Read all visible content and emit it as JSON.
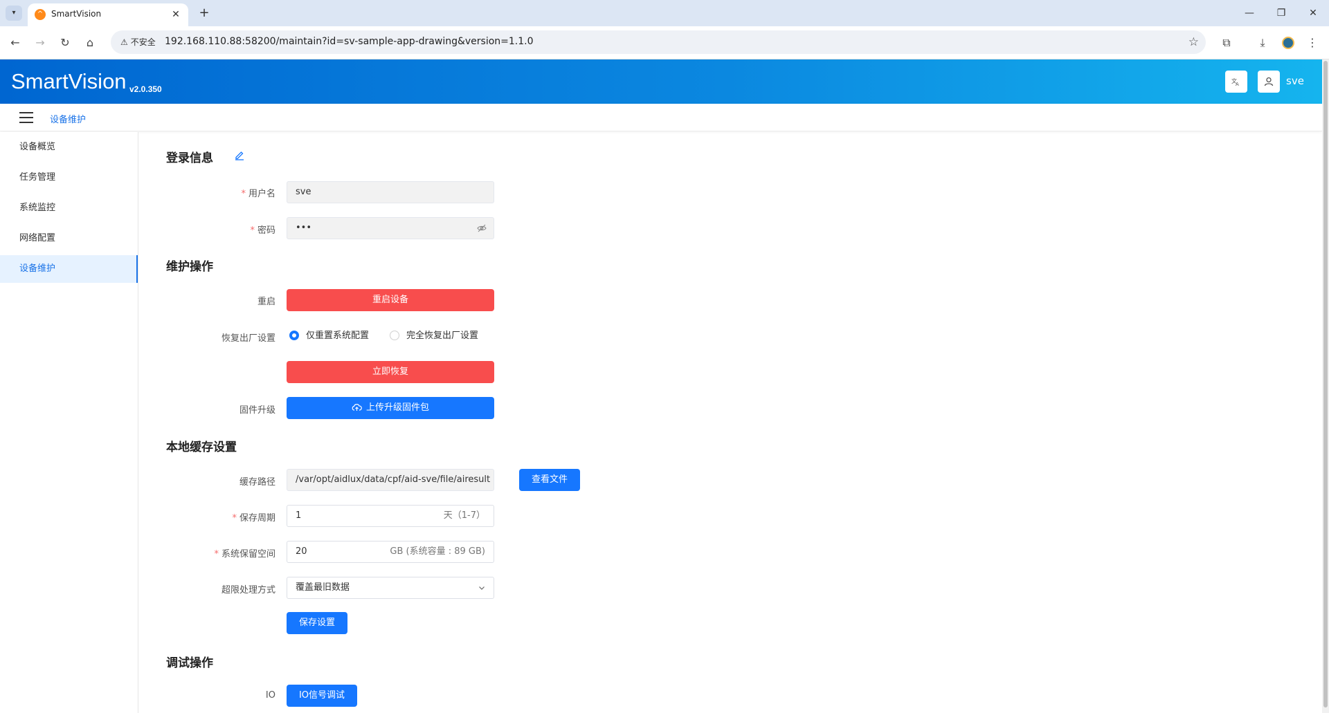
{
  "browser": {
    "tab_title": "SmartVision",
    "security_label": "不安全",
    "url": "192.168.110.88:58200/maintain?id=sv-sample-app-drawing&version=1.1.0"
  },
  "app": {
    "name": "SmartVision",
    "version": "v2.0.350",
    "user": "sve"
  },
  "breadcrumb": {
    "current": "设备维护"
  },
  "sidebar": {
    "items": [
      {
        "label": "设备概览"
      },
      {
        "label": "任务管理"
      },
      {
        "label": "系统监控"
      },
      {
        "label": "网络配置"
      },
      {
        "label": "设备维护",
        "active": true
      }
    ]
  },
  "login": {
    "title": "登录信息",
    "username_label": "用户名",
    "username_value": "sve",
    "password_label": "密码",
    "password_value": "•••"
  },
  "maintenance": {
    "title": "维护操作",
    "restart_label": "重启",
    "restart_button": "重启设备",
    "factory_label": "恢复出厂设置",
    "factory_options": [
      {
        "label": "仅重置系统配置",
        "checked": true
      },
      {
        "label": "完全恢复出厂设置",
        "checked": false
      }
    ],
    "restore_button": "立即恢复",
    "firmware_label": "固件升级",
    "firmware_button": "上传升级固件包"
  },
  "cache": {
    "title": "本地缓存设置",
    "path_label": "缓存路径",
    "path_value": "/var/opt/aidlux/data/cpf/aid-sve/file/airesult",
    "view_files_button": "查看文件",
    "period_label": "保存周期",
    "period_value": "1",
    "period_suffix": "天（1-7）",
    "reserve_label": "系统保留空间",
    "reserve_value": "20",
    "reserve_suffix": "GB (系统容量 : 89 GB)",
    "overflow_label": "超限处理方式",
    "overflow_value": "覆盖最旧数据",
    "save_button": "保存设置"
  },
  "debug": {
    "title": "调试操作",
    "io_label": "IO",
    "io_button": "IO信号调试"
  },
  "colors": {
    "primary": "#1677ff",
    "danger": "#f84d4d",
    "header_gradient_start": "#0066d1",
    "header_gradient_end": "#15b4ee"
  }
}
